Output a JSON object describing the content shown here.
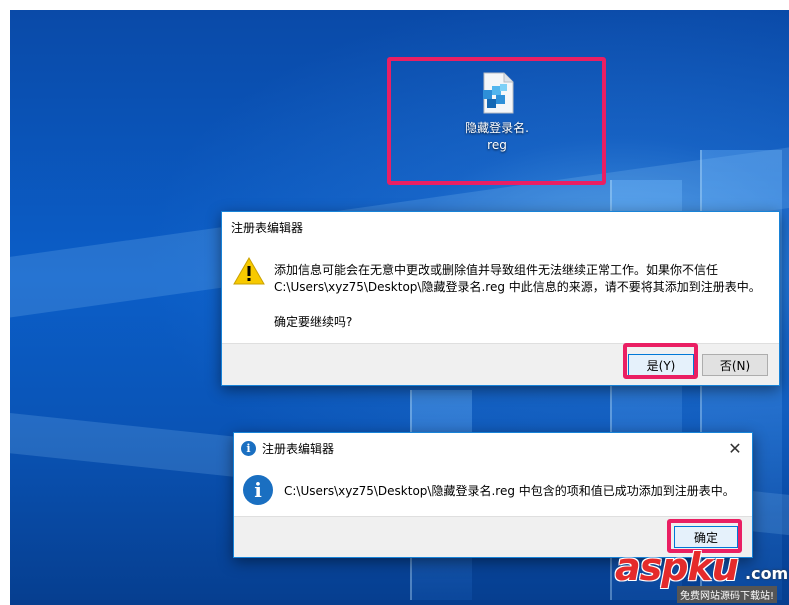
{
  "desktop": {
    "file_icon": {
      "name": "隐藏登录名.\nreg",
      "icon": "registry-file-icon"
    }
  },
  "warning_dialog": {
    "title": "注册表编辑器",
    "icon": "warning-icon",
    "message_line1": "添加信息可能会在无意中更改或删除值并导致组件无法继续正常工作。如果你不信任",
    "message_line2": "C:\\Users\\xyz75\\Desktop\\隐藏登录名.reg 中此信息的来源，请不要将其添加到注册表中。",
    "question": "确定要继续吗?",
    "yes_label": "是(Y)",
    "no_label": "否(N)"
  },
  "info_dialog": {
    "title": "注册表编辑器",
    "icon": "info-icon",
    "message": "C:\\Users\\xyz75\\Desktop\\隐藏登录名.reg 中包含的项和值已成功添加到注册表中。",
    "ok_label": "确定",
    "close_icon": "close-icon"
  },
  "watermark": {
    "brand": "aspku",
    "suffix": ".com",
    "tagline": "免费网站源码下载站!"
  },
  "colors": {
    "highlight": "#ea1f63",
    "dialog_border": "#1883d7",
    "warning": "#f7c900",
    "info": "#1a6fc1"
  }
}
